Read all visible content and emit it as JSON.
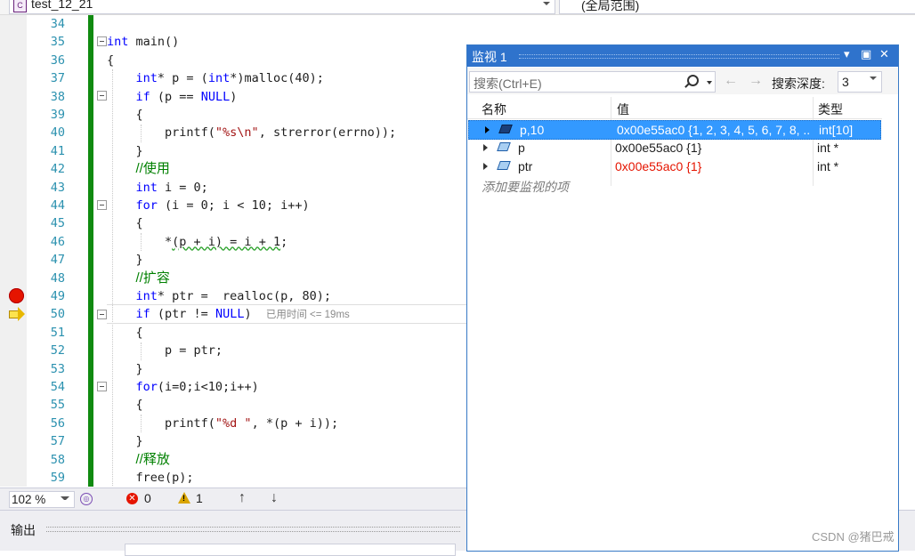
{
  "nav": {
    "file_label": "test_12_21",
    "scope_label": "(全局范围)"
  },
  "editor": {
    "line_numbers": [
      "34",
      "35",
      "36",
      "37",
      "38",
      "39",
      "40",
      "41",
      "42",
      "43",
      "44",
      "45",
      "46",
      "47",
      "48",
      "49",
      "50",
      "51",
      "52",
      "53",
      "54",
      "55",
      "56",
      "57",
      "58",
      "59"
    ],
    "breakpoint_line": "49",
    "current_line": "50",
    "elapsed_hint": "已用时间 <= 19ms"
  },
  "status": {
    "zoom": "102 %",
    "errors": "0",
    "warnings": "1"
  },
  "output": {
    "title": "输出"
  },
  "watch": {
    "title": "监视 1",
    "search_placeholder": "搜索(Ctrl+E)",
    "depth_label": "搜索深度:",
    "depth_value": "3",
    "columns": {
      "name": "名称",
      "value": "值",
      "type": "类型"
    },
    "rows": [
      {
        "name": "p,10",
        "value": "0x00e55ac0 {1, 2, 3, 4, 5, 6, 7, 8, ...",
        "type": "int[10]",
        "selected": true,
        "changed": false
      },
      {
        "name": "p",
        "value": "0x00e55ac0 {1}",
        "type": "int *",
        "selected": false,
        "changed": false
      },
      {
        "name": "ptr",
        "value": "0x00e55ac0 {1}",
        "type": "int *",
        "selected": false,
        "changed": true
      }
    ],
    "add_item": "添加要监视的项"
  },
  "watermark": "CSDN @猪巴戒",
  "colors": {
    "accent": "#2f73cc",
    "selection": "#3399ff",
    "breakpoint": "#e51400",
    "track_changes": "#108a10",
    "changed_value": "#e51400"
  }
}
